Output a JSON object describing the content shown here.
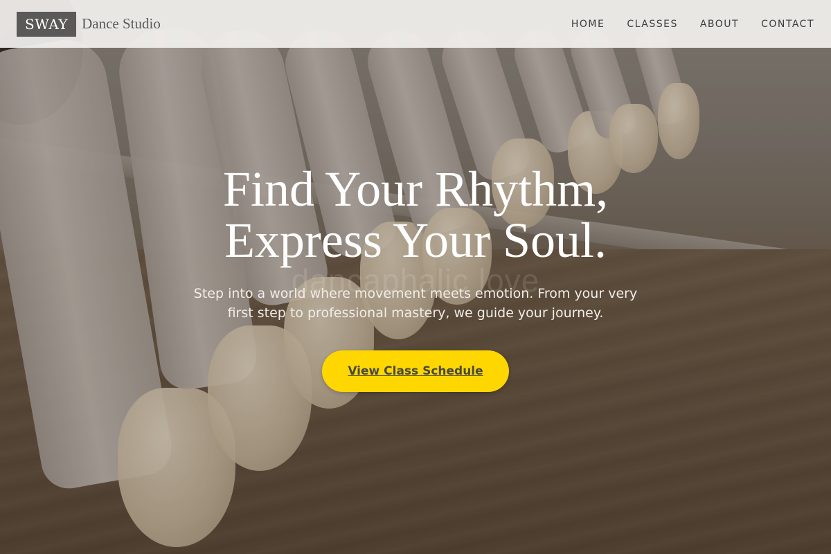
{
  "brand": {
    "logo_text": "SWAY",
    "subtitle": "Dance Studio"
  },
  "nav": {
    "items": [
      {
        "label": "HOME"
      },
      {
        "label": "CLASSES"
      },
      {
        "label": "ABOUT"
      },
      {
        "label": "CONTACT"
      }
    ]
  },
  "hero": {
    "title_line1": "Find Your Rhythm,",
    "title_line2": "Express Your Soul.",
    "watermark": "dancaphalic love",
    "subtitle_line1": "Step into a world where movement meets emotion. From your very",
    "subtitle_line2": "first step to professional mastery, we guide your journey.",
    "cta_label": "View Class Schedule"
  },
  "colors": {
    "cta_background": "#ffd700",
    "header_background": "#f0eeec",
    "logo_background": "#5b5958"
  }
}
